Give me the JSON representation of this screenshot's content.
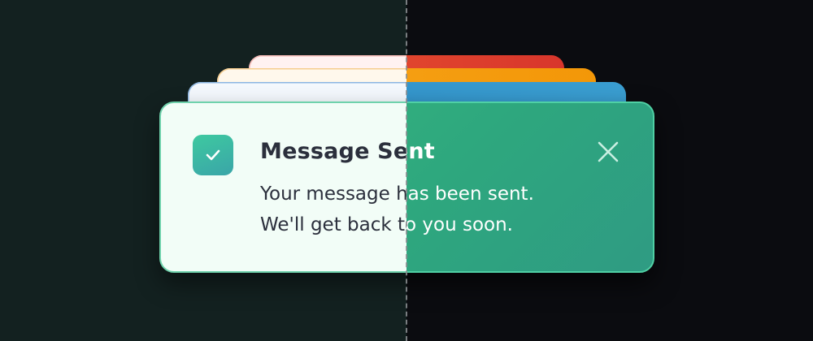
{
  "toast": {
    "title": "Message Sent",
    "message_line1": "Your message has been sent.",
    "message_line2": "We'll get back to you soon.",
    "status_icon": "check-icon",
    "close_icon": "close-icon"
  },
  "themes": {
    "light": {
      "background": "#132120",
      "toast_bg": "#f2fdf7",
      "text": "#2b2f3c"
    },
    "dark": {
      "background": "#0b0c10",
      "toast_bg": "#35b87e",
      "text": "#ffffff"
    }
  },
  "stacked_toast_colors": [
    "#e9532f",
    "#f7a51b",
    "#2f8fc9"
  ]
}
